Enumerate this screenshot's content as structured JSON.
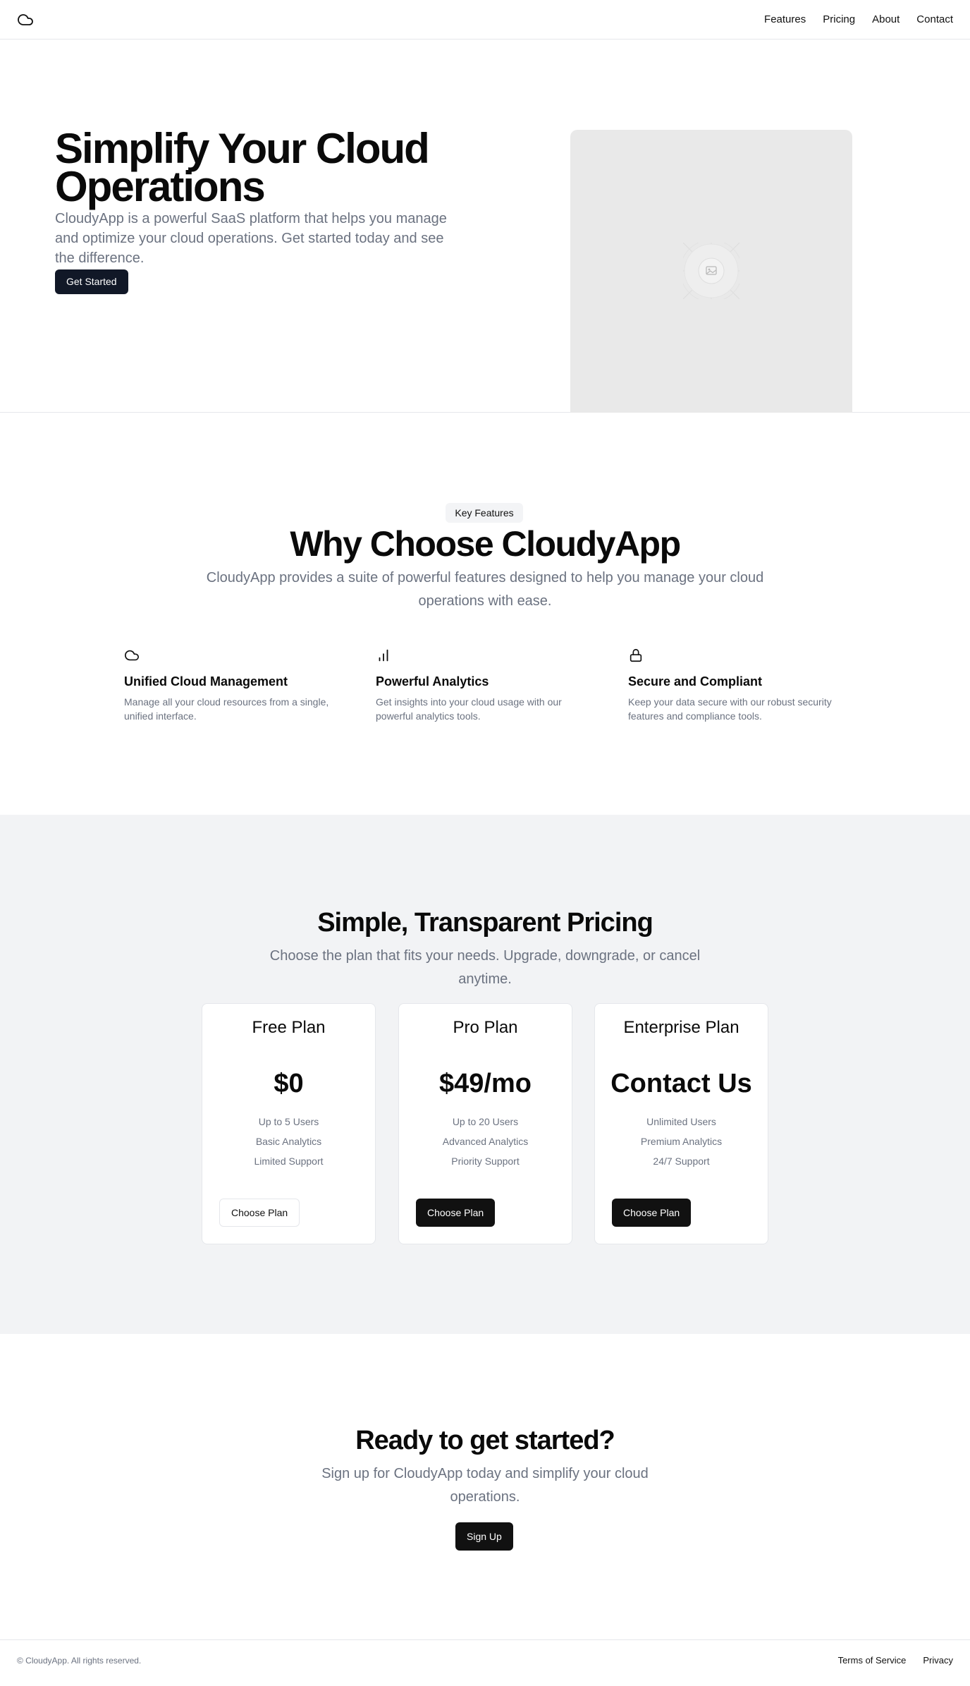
{
  "header": {
    "logo_icon": "cloud-icon",
    "nav": [
      "Features",
      "Pricing",
      "About",
      "Contact"
    ]
  },
  "hero": {
    "title": "Simplify Your Cloud Operations",
    "description": "CloudyApp is a powerful SaaS platform that helps you manage and optimize your cloud operations. Get started today and see the difference.",
    "button": "Get Started",
    "image_icon": "image-placeholder-icon"
  },
  "features": {
    "badge": "Key Features",
    "title": "Why Choose CloudyApp",
    "description": "CloudyApp provides a suite of powerful features designed to help you manage your cloud operations with ease.",
    "items": [
      {
        "icon": "cloud-icon",
        "title": "Unified Cloud Management",
        "description": "Manage all your cloud resources from a single, unified interface."
      },
      {
        "icon": "bar-chart-icon",
        "title": "Powerful Analytics",
        "description": "Get insights into your cloud usage with our powerful analytics tools."
      },
      {
        "icon": "lock-icon",
        "title": "Secure and Compliant",
        "description": "Keep your data secure with our robust security features and compliance tools."
      }
    ]
  },
  "pricing": {
    "title": "Simple, Transparent Pricing",
    "description": "Choose the plan that fits your needs. Upgrade, downgrade, or cancel anytime.",
    "plans": [
      {
        "name": "Free Plan",
        "price": "$0",
        "features": [
          "Up to 5 Users",
          "Basic Analytics",
          "Limited Support"
        ],
        "button": "Choose Plan"
      },
      {
        "name": "Pro Plan",
        "price": "$49/mo",
        "features": [
          "Up to 20 Users",
          "Advanced Analytics",
          "Priority Support"
        ],
        "button": "Choose Plan"
      },
      {
        "name": "Enterprise Plan",
        "price": "Contact Us",
        "features": [
          "Unlimited Users",
          "Premium Analytics",
          "24/7 Support"
        ],
        "button": "Choose Plan"
      }
    ]
  },
  "cta": {
    "title": "Ready to get started?",
    "description": "Sign up for CloudyApp today and simplify your cloud operations.",
    "button": "Sign Up"
  },
  "footer": {
    "copyright": "© CloudyApp. All rights reserved.",
    "links": [
      "Terms of Service",
      "Privacy"
    ]
  },
  "colors": {
    "primary_button": "#111827",
    "muted_text": "#6b7280",
    "pricing_bg": "#f2f3f5",
    "image_placeholder": "#e9e9e9"
  }
}
